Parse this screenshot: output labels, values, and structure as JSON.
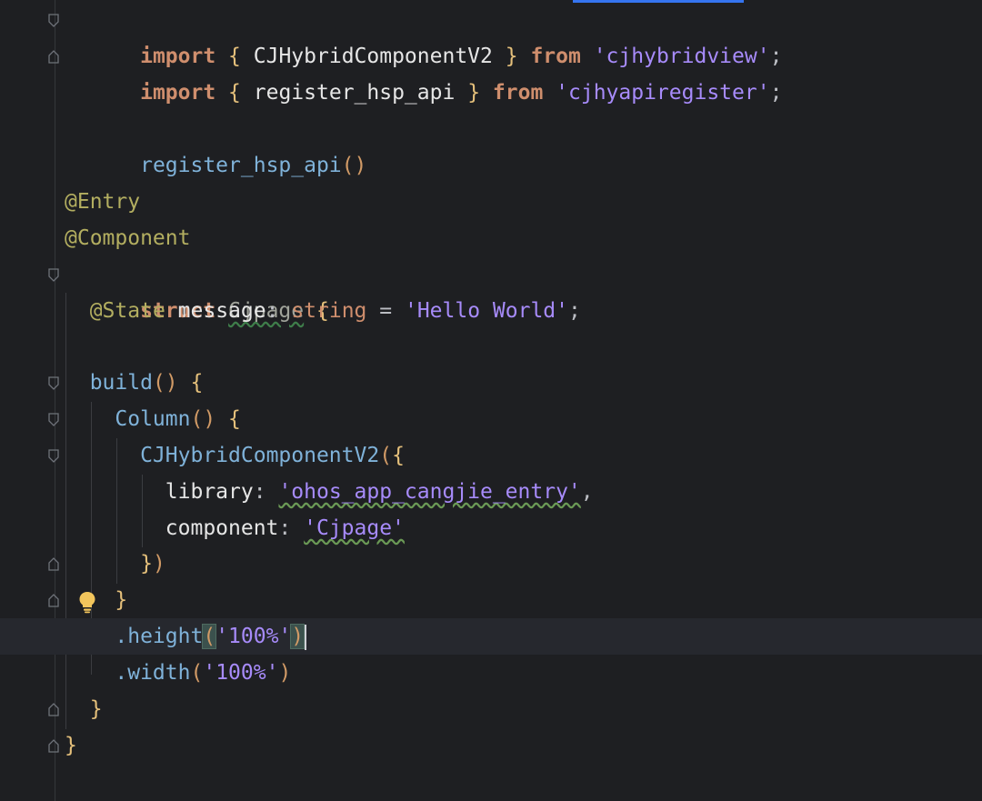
{
  "editor": {
    "language": "ArkTS",
    "colors": {
      "background": "#1e1f22",
      "current_line": "#26282e",
      "keyword": "#cf8e6d",
      "string": "#a78bfa",
      "function": "#56a8f5",
      "annotation": "#b3ae60",
      "identifier": "#bcbec4"
    },
    "lines": [
      {
        "t1": "import",
        "t2": "{",
        "t3": "CJHybridComponentV2",
        "t4": "}",
        "t5": "from",
        "t6": "'cjhybridview'",
        "t7": ";"
      },
      {
        "t1": "import",
        "t2": "{",
        "t3": "register_hsp_api",
        "t4": "}",
        "t5": "from",
        "t6": "'cjhyapiregister'",
        "t7": ";"
      },
      {
        "t1": "register_hsp_api",
        "t2": "()"
      },
      {
        "t1": "@Entry"
      },
      {
        "t1": "@Component"
      },
      {
        "t1": "struct",
        "t2": "Cjpage",
        "t3": "{"
      },
      {
        "t1": "@State",
        "t2": "message",
        "t3": ":",
        "t4": "string",
        "t5": "=",
        "t6": "'Hello World'",
        "t7": ";"
      },
      {
        "t1": "build",
        "t2": "()",
        "t3": "{"
      },
      {
        "t1": "Column",
        "t2": "()",
        "t3": "{"
      },
      {
        "t1": "CJHybridComponentV2",
        "t2": "(",
        "t3": "{"
      },
      {
        "t1": "library",
        "t2": ":",
        "t3": "'ohos_app_cangjie_entry'",
        "t4": ","
      },
      {
        "t1": "component",
        "t2": ":",
        "t3": "'Cjpage'"
      },
      {
        "t1": "}",
        "t2": ")"
      },
      {
        "t1": "}"
      },
      {
        "t1": ".height",
        "t2": "(",
        "t3": "'100%'",
        "t4": ")"
      },
      {
        "t1": ".width",
        "t2": "(",
        "t3": "'100%'",
        "t4": ")"
      },
      {
        "t1": "}"
      },
      {
        "t1": "}"
      }
    ],
    "icons": {
      "fold": "fold-marker-icon",
      "intention": "lightbulb-icon"
    }
  }
}
